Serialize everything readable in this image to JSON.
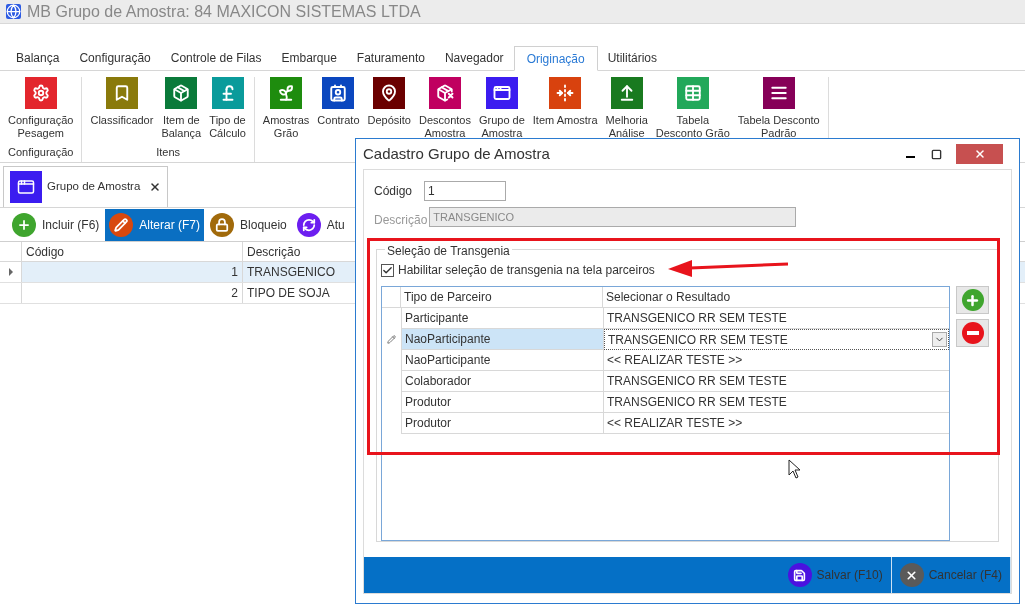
{
  "window": {
    "title": "MB Grupo de Amostra: 84 MAXICON SISTEMAS LTDA"
  },
  "menu_tabs": [
    {
      "label": "Balança",
      "selected": false
    },
    {
      "label": "Configuração",
      "selected": false
    },
    {
      "label": "Controle de Filas",
      "selected": false
    },
    {
      "label": "Embarque",
      "selected": false
    },
    {
      "label": "Faturamento",
      "selected": false
    },
    {
      "label": "Navegador",
      "selected": false
    },
    {
      "label": "Originação",
      "selected": true
    },
    {
      "label": "Utilitários",
      "selected": false
    }
  ],
  "ribbon_groups": [
    {
      "label": "Configuração",
      "items": [
        {
          "label": "Configuração\nPesagem",
          "color": "#e3262d"
        }
      ]
    },
    {
      "label": "Itens",
      "items": [
        {
          "label": "Classificador",
          "color": "#8a7a0b"
        },
        {
          "label": "Item de\nBalança",
          "color": "#0a7a3a"
        },
        {
          "label": "Tipo de\nCálculo",
          "color": "#0a9b9b"
        }
      ]
    },
    {
      "items": [
        {
          "label": "Amostras\nGrão",
          "color": "#1e8c0e"
        },
        {
          "label": "Contrato",
          "color": "#0b47bf"
        },
        {
          "label": "Depósito",
          "color": "#6b0000"
        },
        {
          "label": "Descontos\nAmostra",
          "color": "#c00060"
        },
        {
          "label": "Grupo de\nAmostra",
          "color": "#3b1cf0"
        },
        {
          "label": "Item Amostra",
          "color": "#d8420e"
        },
        {
          "label": "Melhoria\nAnálise",
          "color": "#197a1f"
        },
        {
          "label": "Tabela\nDesconto Grão",
          "color": "#22a85a"
        },
        {
          "label": "Tabela Desconto\nPadrão",
          "color": "#860058"
        }
      ]
    }
  ],
  "doc_tab": {
    "label": "Grupo de Amostra"
  },
  "toolbar": [
    {
      "label": "Incluir (F6)",
      "color": "#3fa52e",
      "selected": false
    },
    {
      "label": "Alterar (F7)",
      "color": "#d8480e",
      "selected": true
    },
    {
      "label": "Bloqueio",
      "color": "#a16a0b",
      "selected": false
    },
    {
      "label": "Atu",
      "color": "#6c1ef0",
      "selected": false
    }
  ],
  "table": {
    "columns": [
      "Código",
      "Descrição"
    ],
    "rows": [
      {
        "cells": [
          "1",
          "TRANSGENICO"
        ],
        "selected": true
      },
      {
        "cells": [
          "2",
          "TIPO DE SOJA"
        ],
        "selected": false
      }
    ]
  },
  "dialog": {
    "title": "Cadastro Grupo de Amostra",
    "codigo": {
      "label": "Código",
      "value": "1",
      "disabled": false
    },
    "descricao": {
      "label": "Descrição",
      "value": "TRANSGENICO",
      "disabled": true
    },
    "group": {
      "title": "Seleção de Transgenia",
      "checkbox": {
        "label": "Habilitar seleção de transgenia na tela parceiros",
        "checked": true
      },
      "columns": [
        "Tipo de Parceiro",
        "Selecionar o Resultado"
      ],
      "rows": [
        {
          "tipo": "Participante",
          "resultado": "TRANSGENICO RR SEM TESTE",
          "selected": false
        },
        {
          "tipo": "NaoParticipante",
          "resultado": "TRANSGENICO RR SEM TESTE",
          "selected": true
        },
        {
          "tipo": "NaoParticipante",
          "resultado": "<< REALIZAR TESTE >>",
          "selected": false
        },
        {
          "tipo": "Colaborador",
          "resultado": "TRANSGENICO RR SEM TESTE",
          "selected": false
        },
        {
          "tipo": "Produtor",
          "resultado": "TRANSGENICO RR SEM TESTE",
          "selected": false
        },
        {
          "tipo": "Produtor",
          "resultado": "<< REALIZAR TESTE >>",
          "selected": false
        }
      ]
    },
    "footer_buttons": [
      {
        "label": "Salvar (F10)",
        "color": "#4a12e0"
      },
      {
        "label": "Cancelar (F4)",
        "color": "#5a5a5a"
      }
    ]
  }
}
